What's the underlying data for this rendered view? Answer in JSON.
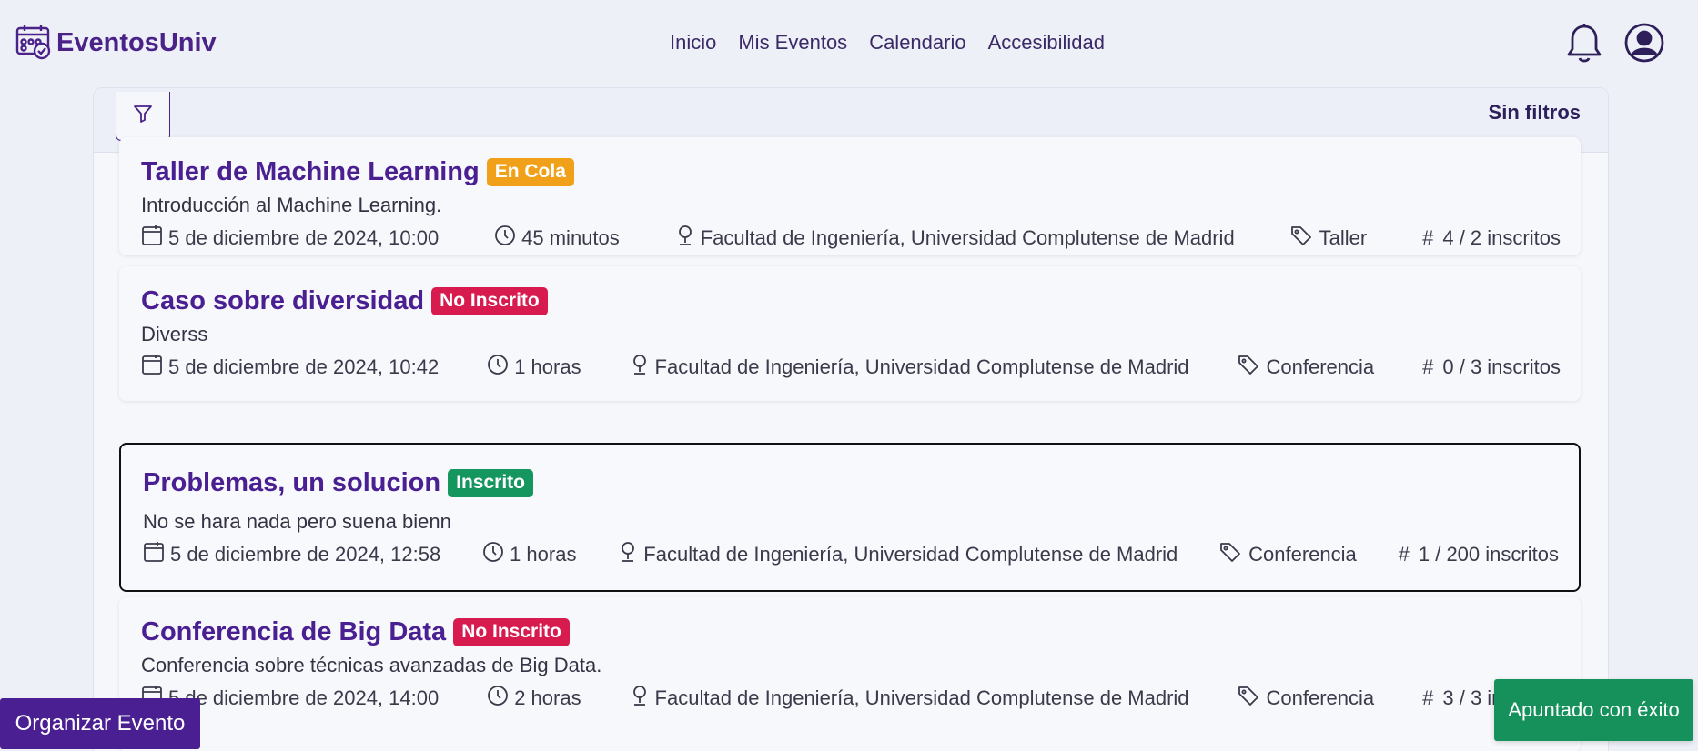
{
  "brand": {
    "name": "EventosUniv",
    "icon": "calendar-check-icon",
    "color": "#4a2288"
  },
  "nav": {
    "links": [
      "Inicio",
      "Mis Eventos",
      "Calendario",
      "Accesibilidad"
    ],
    "notification_icon": "bell-icon",
    "profile_icon": "user-circle-icon"
  },
  "filters": {
    "icon": "filter-icon",
    "status": "Sin filtros"
  },
  "events": [
    {
      "title": "Taller de Machine Learning",
      "status": "En Cola",
      "status_color": "#f0a019",
      "description": "Introducción al Machine Learning.",
      "date": "5 de diciembre de 2024, 10:00",
      "duration": "45 minutos",
      "location": "Facultad de Ingeniería, Universidad Complutense de Madrid",
      "category": "Taller",
      "registered": "4 / 2 inscritos"
    },
    {
      "title": "Caso sobre diversidad",
      "status": "No Inscrito",
      "status_color": "#d81b4f",
      "description": "Diverss",
      "date": "5 de diciembre de 2024, 10:42",
      "duration": "1 horas",
      "location": "Facultad de Ingeniería, Universidad Complutense de Madrid",
      "category": "Conferencia",
      "registered": "0 / 3 inscritos"
    },
    {
      "title": "Problemas, un solucion",
      "status": "Inscrito",
      "status_color": "#15965e",
      "description": "No se hara nada pero suena bienn",
      "date": "5 de diciembre de 2024, 12:58",
      "duration": "1 horas",
      "location": "Facultad de Ingeniería, Universidad Complutense de Madrid",
      "category": "Conferencia",
      "registered": "1 / 200 inscritos"
    },
    {
      "title": "Conferencia de Big Data",
      "status": "No Inscrito",
      "status_color": "#d81b4f",
      "description": "Conferencia sobre técnicas avanzadas de Big Data.",
      "date": "5 de diciembre de 2024, 14:00",
      "duration": "2 horas",
      "location": "Facultad de Ingeniería, Universidad Complutense de Madrid",
      "category": "Conferencia",
      "registered": "3 / 3 inscritos"
    }
  ],
  "actions": {
    "organize_label": "Organizar Evento"
  },
  "toast": {
    "message": "Apuntado con éxito",
    "color": "#16915c"
  }
}
